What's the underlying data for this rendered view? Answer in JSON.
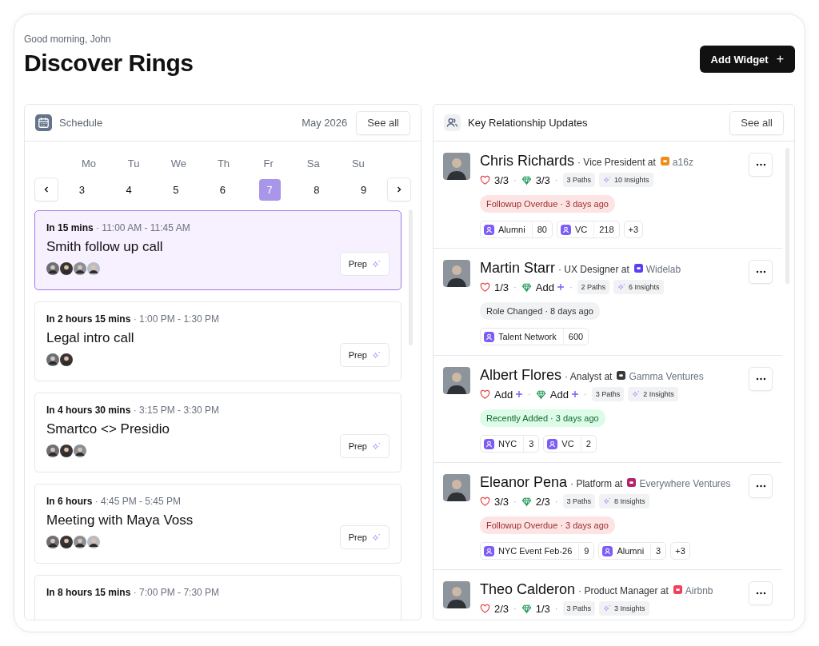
{
  "greeting": "Good morning, John",
  "title": "Discover Rings",
  "add_widget": {
    "label": "Add Widget",
    "icon": "+"
  },
  "schedule": {
    "title": "Schedule",
    "month": "May 2026",
    "see_all": "See all",
    "days": [
      {
        "weekday": "Mo",
        "date": "3",
        "selected": false
      },
      {
        "weekday": "Tu",
        "date": "4",
        "selected": false
      },
      {
        "weekday": "We",
        "date": "5",
        "selected": false
      },
      {
        "weekday": "Th",
        "date": "6",
        "selected": false
      },
      {
        "weekday": "Fr",
        "date": "7",
        "selected": true
      },
      {
        "weekday": "Sa",
        "date": "8",
        "selected": false
      },
      {
        "weekday": "Su",
        "date": "9",
        "selected": false
      }
    ],
    "events": [
      {
        "time": "**In 15 mins** · 11:00 AM - 11:45 AM",
        "title": "Smith follow up call",
        "selected": true,
        "attendees": [
          {
            "kind": "photo"
          },
          {
            "kind": "photo"
          },
          {
            "kind": "photo"
          },
          {
            "kind": "photo"
          }
        ],
        "prep": "Prep"
      },
      {
        "time": "**In 2 hours 15 mins** · 1:00 PM - 1:30 PM",
        "title": "Legal intro call",
        "selected": false,
        "attendees": [
          {
            "kind": "photo"
          },
          {
            "kind": "photo"
          }
        ],
        "prep": "Prep"
      },
      {
        "time": "**In 4 hours 30 mins** · 3:15 PM - 3:30 PM",
        "title": "Smartco <> Presidio",
        "selected": false,
        "attendees": [
          {
            "kind": "photo"
          },
          {
            "kind": "photo"
          },
          {
            "kind": "photo"
          }
        ],
        "prep": "Prep"
      },
      {
        "time": "**In 6 hours** · 4:45 PM - 5:45 PM",
        "title": "Meeting with Maya Voss",
        "selected": false,
        "attendees": [
          {
            "kind": "photo"
          },
          {
            "kind": "photo"
          },
          {
            "kind": "photo"
          },
          {
            "kind": "photo"
          }
        ],
        "prep": "Prep"
      },
      {
        "time": "**In 8 hours 15 mins** · 7:00 PM - 7:30 PM",
        "selected": false
      }
    ]
  },
  "relationships": {
    "title": "Key Relationship Updates",
    "see_all": "See all",
    "people": [
      {
        "name": "Chris Richards",
        "role": "· Vice President at",
        "company": {
          "name": "a16z",
          "color": "#f28c18"
        },
        "warmth": {
          "kind": "value",
          "text": "3/3"
        },
        "value": {
          "kind": "value",
          "text": "3/3"
        },
        "separators": [
          "·",
          "·"
        ],
        "paths": "3 Paths",
        "insights": "10 Insights",
        "status": {
          "kind": "overdue",
          "text": "Followup Overdue · 3 days ago"
        },
        "groups": [
          {
            "label": "Alumni",
            "count": "80"
          },
          {
            "label": "VC",
            "count": "218"
          }
        ],
        "more": "+3"
      },
      {
        "name": "Martin Starr",
        "role": "· UX Designer at",
        "company": {
          "name": "Widelab",
          "color": "#5b3df5"
        },
        "warmth": {
          "kind": "value",
          "text": "1/3"
        },
        "value": {
          "kind": "add",
          "text": "Add"
        },
        "separators": [
          "·",
          "·"
        ],
        "paths": "2 Paths",
        "insights": "6 Insights",
        "status": {
          "kind": "neutral",
          "text": "Role Changed · 8 days ago"
        },
        "groups": [
          {
            "label": "Talent Network",
            "count": "600"
          }
        ]
      },
      {
        "name": "Albert Flores",
        "role": "· Analyst at",
        "company": {
          "name": "Gamma Ventures",
          "color": "#3a3a3a"
        },
        "warmth": {
          "kind": "add",
          "text": "Add"
        },
        "value": {
          "kind": "add",
          "text": "Add"
        },
        "separators": [
          "·",
          "·"
        ],
        "paths": "3 Paths",
        "insights": "2 Insights",
        "status": {
          "kind": "added",
          "text": "Recently Added · 3 days ago"
        },
        "groups": [
          {
            "label": "NYC",
            "count": "3"
          },
          {
            "label": "VC",
            "count": "2"
          }
        ]
      },
      {
        "name": "Eleanor Pena",
        "role": "· Platform at",
        "company": {
          "name": "Everywhere Ventures",
          "color": "#b3246b"
        },
        "warmth": {
          "kind": "value",
          "text": "3/3"
        },
        "value": {
          "kind": "value",
          "text": "2/3"
        },
        "separators": [
          "·",
          "·"
        ],
        "paths": "3 Paths",
        "insights": "8 Insights",
        "status": {
          "kind": "overdue",
          "text": "Followup Overdue · 3 days ago"
        },
        "groups": [
          {
            "label": "NYC Event Feb-26",
            "count": "9"
          },
          {
            "label": "Alumni",
            "count": "3"
          }
        ],
        "more": "+3"
      },
      {
        "name": "Theo Calderon",
        "role": "· Product Manager at",
        "company": {
          "name": "Airbnb",
          "color": "#f0405a"
        },
        "warmth": {
          "kind": "value",
          "text": "2/3"
        },
        "value": {
          "kind": "value",
          "text": "1/3"
        },
        "separators": [
          "·",
          "·"
        ],
        "paths": "3 Paths",
        "insights": "3 Insights"
      }
    ]
  }
}
